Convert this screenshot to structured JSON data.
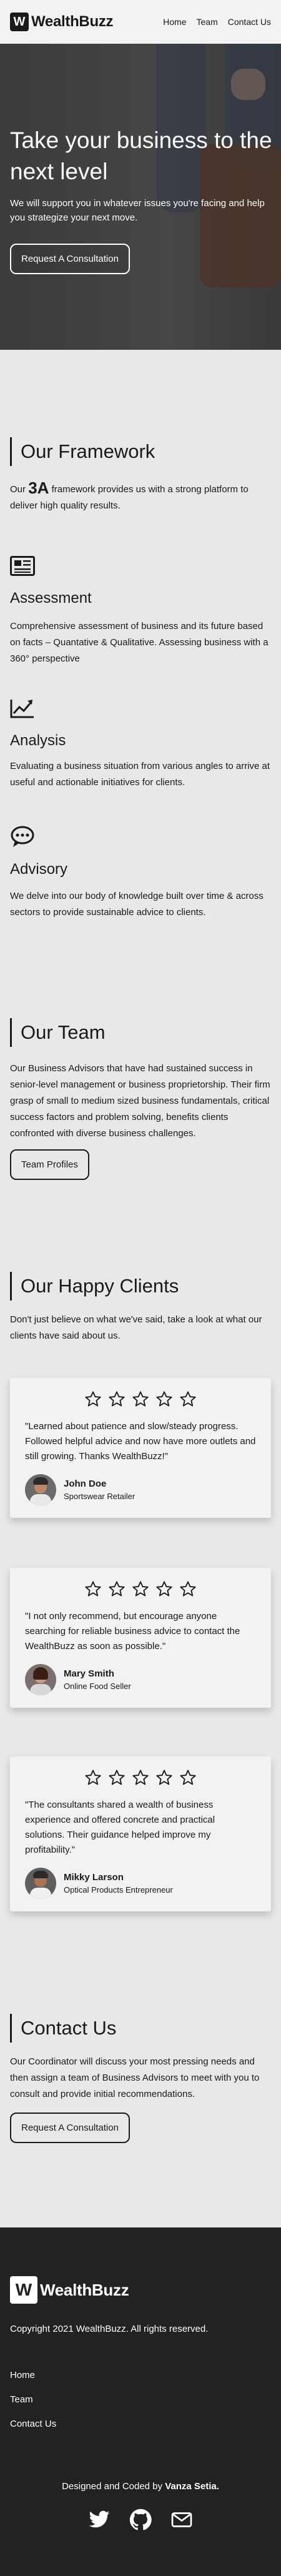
{
  "header": {
    "logo_letter": "W",
    "logo_text": "WealthBuzz",
    "nav": [
      "Home",
      "Team",
      "Contact Us"
    ]
  },
  "hero": {
    "title": "Take your business to the next level",
    "subtitle": "We will support you in whatever issues you're facing and help you strategize your next move.",
    "cta": "Request A Consultation"
  },
  "framework": {
    "heading": "Our Framework",
    "intro_before": "Our ",
    "intro_emph": "3A",
    "intro_after": " framework provides us with a strong platform to deliver high quality results.",
    "items": [
      {
        "icon": "newspaper-icon",
        "title": "Assessment",
        "text": "Comprehensive assessment of business and its future based on facts – Quantative & Qualitative. Assessing business with a 360° perspective"
      },
      {
        "icon": "trending-up-icon",
        "title": "Analysis",
        "text": "Evaluating a business situation from various angles to arrive at useful and actionable initiatives for clients."
      },
      {
        "icon": "chat-bubble-icon",
        "title": "Advisory",
        "text": "We delve into our body of knowledge built over time & across sectors to provide sustainable advice to clients."
      }
    ]
  },
  "team": {
    "heading": "Our Team",
    "text": "Our Business Advisors that have had sustained success in senior-level management or business proprietorship. Their firm grasp of small to medium sized business fundamentals, critical success factors and problem solving, benefits clients confronted with diverse business challenges.",
    "button": "Team Profiles"
  },
  "clients": {
    "heading": "Our Happy Clients",
    "intro": "Don't just believe on what we've said, take a look at what our clients have said about us.",
    "testimonials": [
      {
        "rating": 5,
        "quote": "\"Learned about patience and slow/steady progress. Followed helpful advice and now have more outlets and still growing. Thanks WealthBuzz!\"",
        "name": "John Doe",
        "role": "Sportswear Retailer"
      },
      {
        "rating": 5,
        "quote": "\"I not only recommend, but encourage anyone searching for reliable business advice to contact the WealthBuzz as soon as possible.\"",
        "name": "Mary Smith",
        "role": "Online Food Seller"
      },
      {
        "rating": 5,
        "quote": "\"The consultants shared a wealth of business experience and offered concrete and practical solutions. Their guidance helped improve my profitability.\"",
        "name": "Mikky Larson",
        "role": "Optical Products Entrepreneur"
      }
    ]
  },
  "contact": {
    "heading": "Contact Us",
    "text": "Our Coordinator will discuss your most pressing needs and then assign a team of Business Advisors to meet with you to consult and provide initial recommendations.",
    "button": "Request A Consultation"
  },
  "footer": {
    "logo_letter": "W",
    "logo_text": "WealthBuzz",
    "copyright": "Copyright 2021 WealthBuzz. All rights reserved.",
    "links": [
      "Home",
      "Team",
      "Contact Us"
    ],
    "credit_prefix": "Designed and Coded by ",
    "credit_name": "Vanza Setia.",
    "socials": [
      "twitter-icon",
      "github-icon",
      "mail-icon"
    ]
  },
  "colors": {
    "page_bg": "#e8e8e8",
    "header_bg": "#f2f2f2",
    "footer_bg": "#222222",
    "text": "#1a1a1a",
    "card_bg": "#f2f2f2"
  }
}
